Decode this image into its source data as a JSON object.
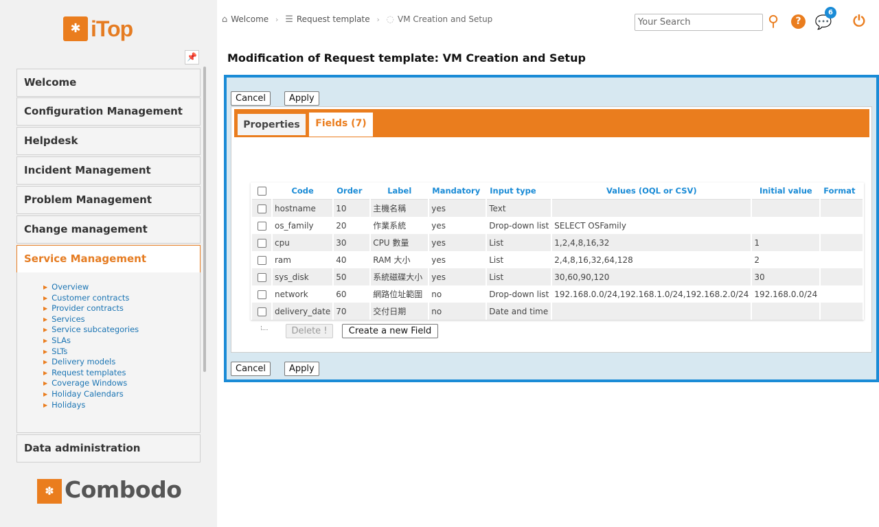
{
  "app": {
    "logo_text": "iTop",
    "vendor_logo_text": "Combodo"
  },
  "sidebar": {
    "pin_icon": "pin-icon",
    "groups": [
      {
        "label": "Welcome"
      },
      {
        "label": "Configuration Management"
      },
      {
        "label": "Helpdesk"
      },
      {
        "label": "Incident Management"
      },
      {
        "label": "Problem Management"
      },
      {
        "label": "Change management"
      },
      {
        "label": "Service Management",
        "active": true
      },
      {
        "label": "Data administration"
      }
    ],
    "service_items": [
      "Overview",
      "Customer contracts",
      "Provider contracts",
      "Services",
      "Service subcategories",
      "SLAs",
      "SLTs",
      "Delivery models",
      "Request templates",
      "Coverage Windows",
      "Holiday Calendars",
      "Holidays"
    ]
  },
  "header": {
    "breadcrumb": [
      {
        "label": "Welcome",
        "icon": "home-icon"
      },
      {
        "label": "Request template",
        "icon": "list-icon"
      },
      {
        "label": "VM Creation and Setup",
        "icon": "object-icon"
      }
    ],
    "search": {
      "placeholder": "Your Search"
    },
    "notification_count": "6"
  },
  "page": {
    "title": "Modification of Request template: VM Creation and Setup",
    "buttons": {
      "cancel": "Cancel",
      "apply": "Apply",
      "delete": "Delete !",
      "create": "Create a new Field"
    },
    "tabs": [
      {
        "label": "Properties"
      },
      {
        "label": "Fields (7)"
      }
    ],
    "table": {
      "headers": [
        "Code",
        "Order",
        "Label",
        "Mandatory",
        "Input type",
        "Values (OQL or CSV)",
        "Initial value",
        "Format"
      ],
      "rows": [
        [
          "hostname",
          "10",
          "主機名稱",
          "yes",
          "Text",
          "",
          "",
          ""
        ],
        [
          "os_family",
          "20",
          "作業系統",
          "yes",
          "Drop-down list",
          "SELECT OSFamily",
          "",
          ""
        ],
        [
          "cpu",
          "30",
          "CPU 數量",
          "yes",
          "List",
          "1,2,4,8,16,32",
          "1",
          ""
        ],
        [
          "ram",
          "40",
          "RAM 大小",
          "yes",
          "List",
          "2,4,8,16,32,64,128",
          "2",
          ""
        ],
        [
          "sys_disk",
          "50",
          "系統磁碟大小",
          "yes",
          "List",
          "30,60,90,120",
          "30",
          ""
        ],
        [
          "network",
          "60",
          "網路位址範圍",
          "no",
          "Drop-down list",
          "192.168.0.0/24,192.168.1.0/24,192.168.2.0/24",
          "192.168.0.0/24",
          ""
        ],
        [
          "delivery_date",
          "70",
          "交付日期",
          "no",
          "Date and time",
          "",
          "",
          ""
        ]
      ]
    }
  },
  "colors": {
    "accent": "#ea7d1e",
    "frame": "#1a8bd6",
    "link": "#1a74b3"
  }
}
